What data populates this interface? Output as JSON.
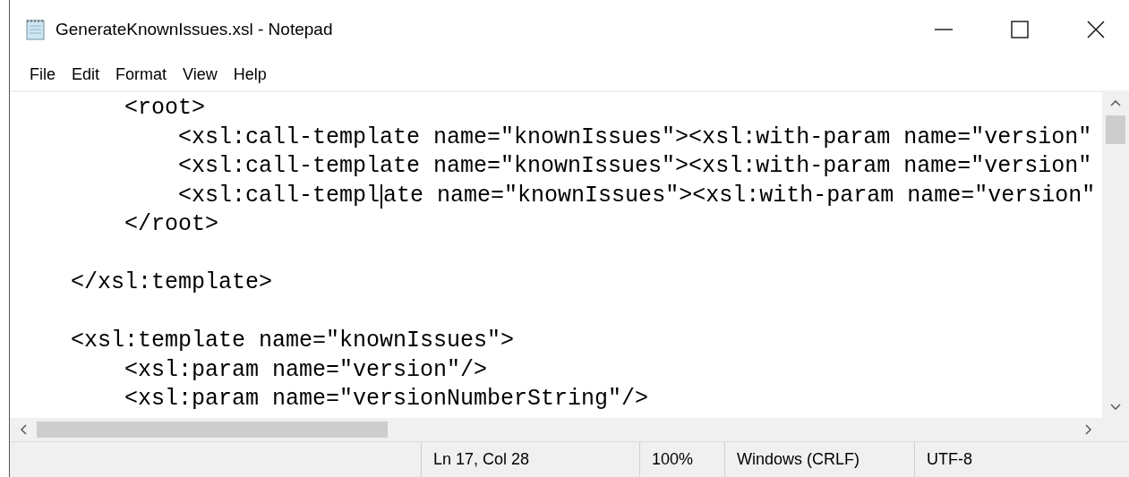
{
  "window": {
    "title": "GenerateKnownIssues.xsl - Notepad"
  },
  "menu": [
    "File",
    "Edit",
    "Format",
    "View",
    "Help"
  ],
  "editor": {
    "lines": [
      {
        "kind": "code",
        "text": "        <root>"
      },
      {
        "kind": "code",
        "text": "            <xsl:call-template name=\"knownIssues\"><xsl:with-param name=\"version\""
      },
      {
        "kind": "code",
        "text": "            <xsl:call-template name=\"knownIssues\"><xsl:with-param name=\"version\""
      },
      {
        "kind": "code",
        "text": "            <xsl:call-templ",
        "after_caret": "ate name=\"knownIssues\"><xsl:with-param name=\"version\""
      },
      {
        "kind": "code",
        "text": "        </root>"
      },
      {
        "kind": "blank"
      },
      {
        "kind": "code",
        "text": "    </xsl:template>"
      },
      {
        "kind": "blank"
      },
      {
        "kind": "code",
        "text": "    <xsl:template name=\"knownIssues\">"
      },
      {
        "kind": "code",
        "text": "        <xsl:param name=\"version\"/>"
      },
      {
        "kind": "code",
        "text": "        <xsl:param name=\"versionNumberString\"/>"
      }
    ]
  },
  "status_bar": [
    "Ln 17, Col 28",
    "100%",
    "Windows (CRLF)",
    "UTF-8"
  ]
}
